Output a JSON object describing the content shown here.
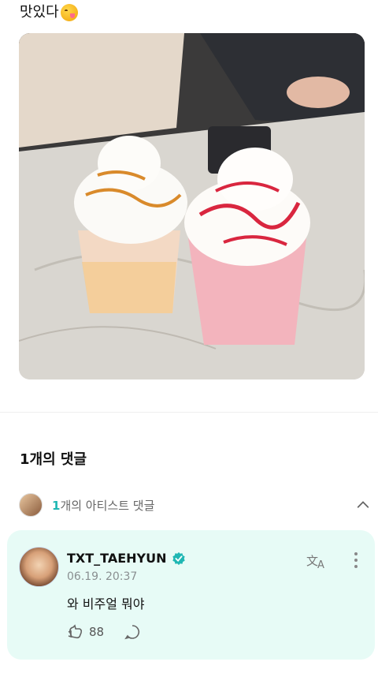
{
  "post": {
    "text": "맛있다",
    "emoji_icon": "yum-face-emoji"
  },
  "comments_section": {
    "count_label": "1개의 댓글",
    "artist_prefix": "1",
    "artist_label_rest": "개의 아티스트 댓글"
  },
  "comment": {
    "username": "TXT_TAEHYUN",
    "verified_icon": "verified-icon",
    "timestamp": "06.19. 20:37",
    "text": "와 비주얼 뭐야",
    "likes": "88"
  },
  "colors": {
    "accent": "#1fb7b3",
    "card_bg": "#e7fbf6",
    "text_muted": "#8a8f91"
  }
}
